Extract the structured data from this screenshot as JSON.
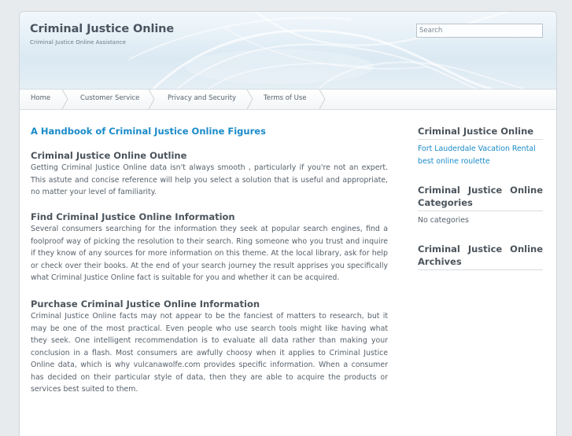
{
  "site": {
    "title": "Criminal Justice Online",
    "description": "Criminal Justice Online Assistance"
  },
  "search": {
    "placeholder": "Search"
  },
  "nav": {
    "items": [
      {
        "label": "Home"
      },
      {
        "label": "Customer Service"
      },
      {
        "label": "Privacy and Security"
      },
      {
        "label": "Terms of Use"
      }
    ]
  },
  "post": {
    "title": "A Handbook of Criminal Justice Online Figures",
    "sections": [
      {
        "heading": "Criminal Justice Online Outline",
        "body": "Getting Criminal Justice Online data isn't always smooth , particularly if you're not an expert. This astute and concise reference will help you select a solution that is useful and appropriate, no matter your level of familiarity."
      },
      {
        "heading": "Find Criminal Justice Online Information",
        "body": "Several consumers searching for the information they seek at popular search engines, find a foolproof way of picking the resolution to their search. Ring someone who you trust and inquire if they know of any sources for more information on this theme. At the local library, ask for help or check over their books. At the end of your search journey the result apprises you specifically what Criminal Justice Online fact is suitable for you and whether it can be acquired."
      },
      {
        "heading": "Purchase Criminal Justice Online Information",
        "body": "Criminal Justice Online facts may not appear to be the fanciest of matters to research, but it may be one of the most practical. Even people who use search tools might like having what they seek. One intelligent recommendation is to evaluate all data rather than making your conclusion in a flash. Most consumers are awfully choosy when it applies to Criminal Justice Online data, which is why vulcanawolfe.com provides specific information. When a consumer has decided on their particular style of data, then they are able to acquire the products or services best suited to them."
      }
    ]
  },
  "sidebar": {
    "widget1": {
      "title": "Criminal Justice Online",
      "links": [
        "Fort Lauderdale Vacation Rental",
        "best online roulette"
      ]
    },
    "widget2": {
      "title": "Criminal Justice Online Categories",
      "text": "No categories"
    },
    "widget3": {
      "title": "Criminal Justice Online Archives"
    }
  },
  "colors": {
    "accent": "#1a8bc9",
    "heading": "#4b545c",
    "body_text": "#57616a",
    "page_background": "#e8ebee"
  }
}
